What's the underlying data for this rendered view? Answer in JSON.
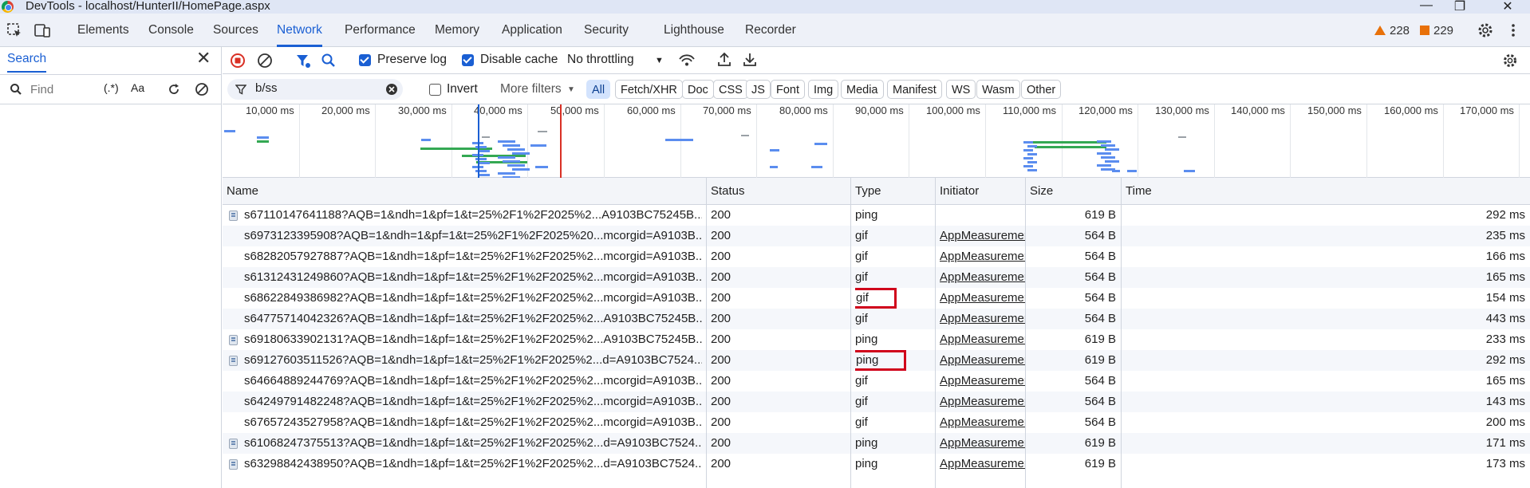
{
  "window": {
    "title": "DevTools - localhost/HunterII/HomePage.aspx"
  },
  "tabs": [
    "Elements",
    "Console",
    "Sources",
    "Network",
    "Performance",
    "Memory",
    "Application",
    "Security",
    "Lighthouse",
    "Recorder"
  ],
  "active_tab": "Network",
  "badges": {
    "warnings": "228",
    "issues": "229"
  },
  "search_panel": {
    "title": "Search",
    "placeholder": "Find",
    "regex_label": "(.*)",
    "case_label": "Aa"
  },
  "toolbar": {
    "preserve_log": "Preserve log",
    "disable_cache": "Disable cache",
    "throttling": "No throttling"
  },
  "filter": {
    "value": "b/ss",
    "invert": "Invert",
    "more_filters": "More filters",
    "types": [
      "All",
      "Fetch/XHR",
      "Doc",
      "CSS",
      "JS",
      "Font",
      "Img",
      "Media",
      "Manifest",
      "WS",
      "Wasm",
      "Other"
    ],
    "active_type": "All"
  },
  "timeline": {
    "ticks": [
      "10,000 ms",
      "20,000 ms",
      "30,000 ms",
      "40,000 ms",
      "50,000 ms",
      "60,000 ms",
      "70,000 ms",
      "80,000 ms",
      "90,000 ms",
      "100,000 ms",
      "110,000 ms",
      "120,000 ms",
      "130,000 ms",
      "140,000 ms",
      "150,000 ms",
      "160,000 ms",
      "170,000 ms"
    ]
  },
  "table": {
    "headers": {
      "name": "Name",
      "status": "Status",
      "type": "Type",
      "initiator": "Initiator",
      "size": "Size",
      "time": "Time"
    },
    "rows": [
      {
        "name": "s67110147641188?AQB=1&ndh=1&pf=1&t=25%2F1%2F2025%2...A9103BC75245B...",
        "status": "200",
        "type": "ping",
        "initiator": "",
        "size": "619 B",
        "time": "292 ms",
        "icon": true,
        "hl": false
      },
      {
        "name": "s6973123395908?AQB=1&ndh=1&pf=1&t=25%2F1%2F2025%20...mcorgid=A9103B...",
        "status": "200",
        "type": "gif",
        "initiator": "AppMeasuremer",
        "size": "564 B",
        "time": "235 ms",
        "icon": false,
        "hl": false
      },
      {
        "name": "s68282057927887?AQB=1&ndh=1&pf=1&t=25%2F1%2F2025%2...mcorgid=A9103B...",
        "status": "200",
        "type": "gif",
        "initiator": "AppMeasuremer",
        "size": "564 B",
        "time": "166 ms",
        "icon": false,
        "hl": false
      },
      {
        "name": "s61312431249860?AQB=1&ndh=1&pf=1&t=25%2F1%2F2025%2...mcorgid=A9103B...",
        "status": "200",
        "type": "gif",
        "initiator": "AppMeasuremer",
        "size": "564 B",
        "time": "165 ms",
        "icon": false,
        "hl": false
      },
      {
        "name": "s68622849386982?AQB=1&ndh=1&pf=1&t=25%2F1%2F2025%2...mcorgid=A9103B...",
        "status": "200",
        "type": "gif",
        "initiator": "AppMeasuremer",
        "size": "564 B",
        "time": "154 ms",
        "icon": false,
        "hl": true
      },
      {
        "name": "s64775714042326?AQB=1&ndh=1&pf=1&t=25%2F1%2F2025%2...A9103BC75245B...",
        "status": "200",
        "type": "gif",
        "initiator": "AppMeasuremer",
        "size": "564 B",
        "time": "443 ms",
        "icon": false,
        "hl": false
      },
      {
        "name": "s69180633902131?AQB=1&ndh=1&pf=1&t=25%2F1%2F2025%2...A9103BC75245B...",
        "status": "200",
        "type": "ping",
        "initiator": "AppMeasuremer",
        "size": "619 B",
        "time": "233 ms",
        "icon": true,
        "hl": false
      },
      {
        "name": "s69127603511526?AQB=1&ndh=1&pf=1&t=25%2F1%2F2025%2...d=A9103BC7524...",
        "status": "200",
        "type": "ping",
        "initiator": "AppMeasuremer",
        "size": "619 B",
        "time": "292 ms",
        "icon": true,
        "hl": true
      },
      {
        "name": "s64664889244769?AQB=1&ndh=1&pf=1&t=25%2F1%2F2025%2...mcorgid=A9103B...",
        "status": "200",
        "type": "gif",
        "initiator": "AppMeasuremer",
        "size": "564 B",
        "time": "165 ms",
        "icon": false,
        "hl": false
      },
      {
        "name": "s64249791482248?AQB=1&ndh=1&pf=1&t=25%2F1%2F2025%2...mcorgid=A9103B...",
        "status": "200",
        "type": "gif",
        "initiator": "AppMeasuremer",
        "size": "564 B",
        "time": "143 ms",
        "icon": false,
        "hl": false
      },
      {
        "name": "s67657243527958?AQB=1&ndh=1&pf=1&t=25%2F1%2F2025%2...mcorgid=A9103B...",
        "status": "200",
        "type": "gif",
        "initiator": "AppMeasuremer",
        "size": "564 B",
        "time": "200 ms",
        "icon": false,
        "hl": false
      },
      {
        "name": "s61068247375513?AQB=1&ndh=1&pf=1&t=25%2F1%2F2025%2...d=A9103BC7524...",
        "status": "200",
        "type": "ping",
        "initiator": "AppMeasuremer",
        "size": "619 B",
        "time": "171 ms",
        "icon": true,
        "hl": false
      },
      {
        "name": "s63298842438950?AQB=1&ndh=1&pf=1&t=25%2F1%2F2025%2...d=A9103BC7524...",
        "status": "200",
        "type": "ping",
        "initiator": "AppMeasuremer",
        "size": "619 B",
        "time": "173 ms",
        "icon": true,
        "hl": false
      }
    ]
  },
  "colors": {
    "accent": "#1a5fd3",
    "highlight": "#d0021b",
    "warning": "#e8710a"
  }
}
